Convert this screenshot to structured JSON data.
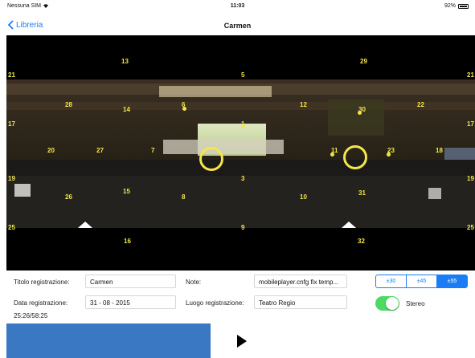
{
  "status_bar": {
    "carrier": "Nessuna SIM",
    "time": "11:03",
    "battery": "92%"
  },
  "nav": {
    "back_label": "Libreria",
    "title": "Carmen"
  },
  "channels": [
    "13",
    "29",
    "21",
    "5",
    "21",
    "28",
    "14",
    "6",
    "12",
    "30",
    "22",
    "17",
    "1",
    "17",
    "20",
    "27",
    "7",
    "11",
    "23",
    "18",
    "19",
    "3",
    "19",
    "26",
    "15",
    "8",
    "10",
    "31",
    "25",
    "9",
    "25",
    "16",
    "32"
  ],
  "form": {
    "title_label": "Titolo registrazione:",
    "title_value": "Carmen",
    "notes_label": "Note:",
    "notes_value": "mobileplayer.cnfg fix temp...",
    "date_label": "Data registrazione:",
    "date_value": "31 - 08 - 2015",
    "place_label": "Luogo registrazione:",
    "place_value": "Teatro Regio",
    "time_readout": "25:26/58:25"
  },
  "segmented": {
    "options": [
      "±30",
      "±45",
      "±55"
    ],
    "selected_index": 2
  },
  "stereo": {
    "label": "Stereo",
    "on": true
  },
  "colors": {
    "accent": "#1a7df5",
    "marker": "#f4e64a",
    "toggle_on": "#4cd964",
    "video": "#3b78c4"
  },
  "icons": {
    "back": "chevron-left-icon",
    "wifi": "wifi-icon",
    "battery": "battery-icon",
    "play": "play-icon"
  }
}
